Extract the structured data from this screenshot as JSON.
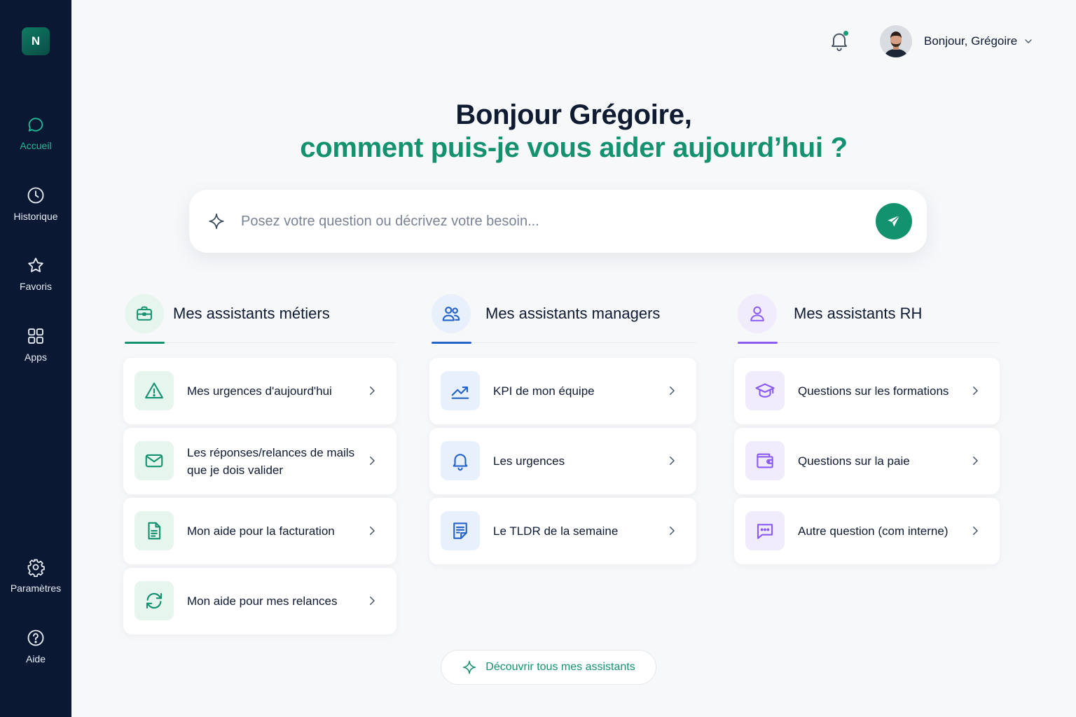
{
  "sidebar": {
    "logo": "N",
    "items": [
      {
        "label": "Accueil",
        "icon": "chat-bubble-icon",
        "active": true
      },
      {
        "label": "Historique",
        "icon": "clock-icon"
      },
      {
        "label": "Favoris",
        "icon": "star-icon"
      },
      {
        "label": "Apps",
        "icon": "grid-icon"
      },
      {
        "label": "Paramètres",
        "icon": "gear-icon"
      },
      {
        "label": "Aide",
        "icon": "help-circle-icon"
      }
    ]
  },
  "header": {
    "user_greeting": "Bonjour, Grégoire",
    "notification_indicator": true
  },
  "hero": {
    "line1": "Bonjour Grégoire,",
    "line2": "comment puis-je vous aider aujourd’hui ?"
  },
  "search": {
    "placeholder": "Posez votre question ou décrivez votre besoin...",
    "value": ""
  },
  "columns": [
    {
      "title": "Mes assistants métiers",
      "icon": "briefcase-icon",
      "accent": "#14926f",
      "items": [
        {
          "label": "Mes urgences d'aujourd'hui",
          "icon": "warning-icon"
        },
        {
          "label": "Les réponses/relances de mails que je dois valider",
          "icon": "mail-icon"
        },
        {
          "label": "Mon aide pour la facturation",
          "icon": "document-icon"
        },
        {
          "label": "Mon aide pour mes relances",
          "icon": "refresh-icon"
        }
      ]
    },
    {
      "title": "Mes assistants managers",
      "icon": "users-icon",
      "accent": "#2563c9",
      "items": [
        {
          "label": "KPI de mon équipe",
          "icon": "trend-up-icon"
        },
        {
          "label": "Les urgences",
          "icon": "bell-icon"
        },
        {
          "label": "Le TLDR de la semaine",
          "icon": "summary-icon"
        }
      ]
    },
    {
      "title": "Mes assistants RH",
      "icon": "user-icon",
      "accent": "#8b5cf6",
      "items": [
        {
          "label": "Questions sur les formations",
          "icon": "graduation-cap-icon"
        },
        {
          "label": "Questions sur la paie",
          "icon": "wallet-icon"
        },
        {
          "label": "Autre question (com interne)",
          "icon": "message-dots-icon"
        }
      ]
    }
  ],
  "discover": {
    "label": "Découvrir tous mes assistants"
  }
}
